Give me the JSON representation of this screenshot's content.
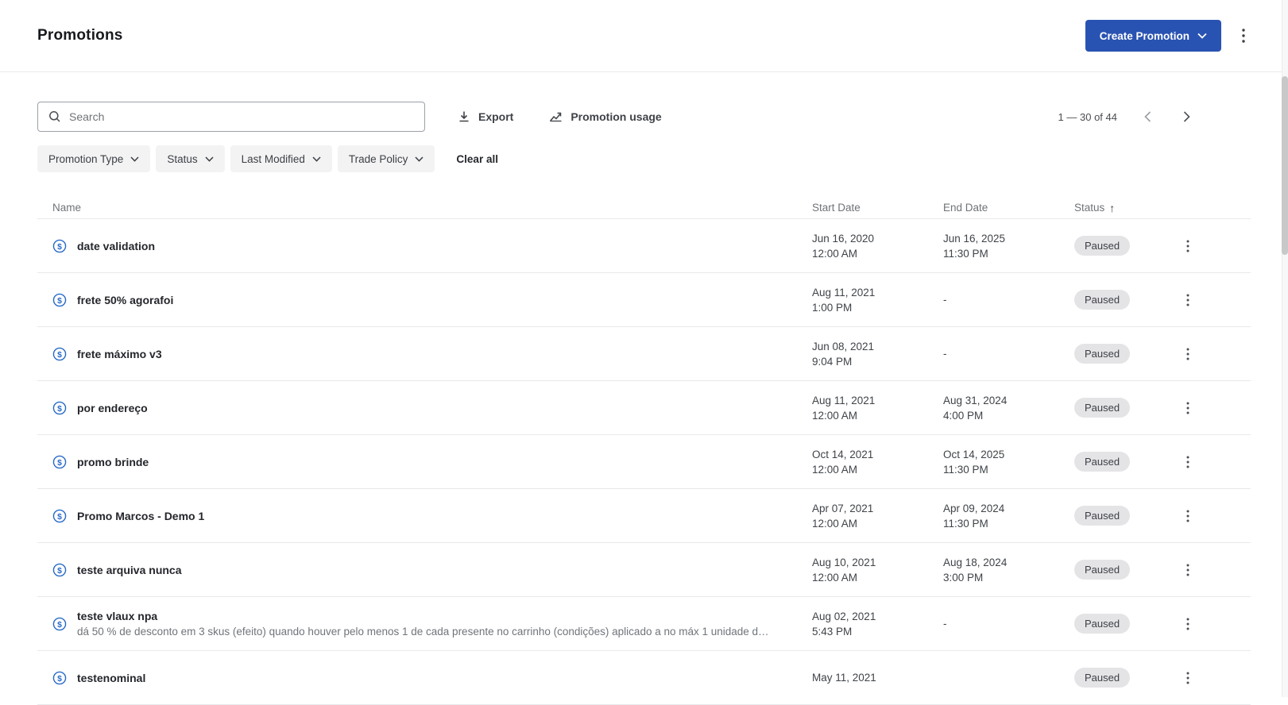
{
  "header": {
    "title": "Promotions",
    "create_button_label": "Create Promotion"
  },
  "toolbar": {
    "search_placeholder": "Search",
    "export_label": "Export",
    "usage_label": "Promotion usage",
    "pagination_range": "1 — 30 of 44"
  },
  "filters": {
    "chips": [
      "Promotion Type",
      "Status",
      "Last Modified",
      "Trade Policy"
    ],
    "clear_all": "Clear all"
  },
  "table": {
    "columns": {
      "name": "Name",
      "start": "Start Date",
      "end": "End Date",
      "status": "Status"
    },
    "sort_indicator": "↑",
    "rows": [
      {
        "name": "date validation",
        "description": "",
        "start": {
          "date": "Jun 16, 2020",
          "time": "12:00 AM"
        },
        "end": {
          "date": "Jun 16, 2025",
          "time": "11:30 PM"
        },
        "status": "Paused"
      },
      {
        "name": "frete 50% agorafoi",
        "description": "",
        "start": {
          "date": "Aug 11, 2021",
          "time": "1:00 PM"
        },
        "end": {
          "date": "-",
          "time": ""
        },
        "status": "Paused"
      },
      {
        "name": "frete máximo v3",
        "description": "",
        "start": {
          "date": "Jun 08, 2021",
          "time": "9:04 PM"
        },
        "end": {
          "date": "-",
          "time": ""
        },
        "status": "Paused"
      },
      {
        "name": "por endereço",
        "description": "",
        "start": {
          "date": "Aug 11, 2021",
          "time": "12:00 AM"
        },
        "end": {
          "date": "Aug 31, 2024",
          "time": "4:00 PM"
        },
        "status": "Paused"
      },
      {
        "name": "promo brinde",
        "description": "",
        "start": {
          "date": "Oct 14, 2021",
          "time": "12:00 AM"
        },
        "end": {
          "date": "Oct 14, 2025",
          "time": "11:30 PM"
        },
        "status": "Paused"
      },
      {
        "name": "Promo Marcos - Demo 1",
        "description": "",
        "start": {
          "date": "Apr 07, 2021",
          "time": "12:00 AM"
        },
        "end": {
          "date": "Apr 09, 2024",
          "time": "11:30 PM"
        },
        "status": "Paused"
      },
      {
        "name": "teste arquiva nunca",
        "description": "",
        "start": {
          "date": "Aug 10, 2021",
          "time": "12:00 AM"
        },
        "end": {
          "date": "Aug 18, 2024",
          "time": "3:00 PM"
        },
        "status": "Paused"
      },
      {
        "name": "teste vlaux npa",
        "description": "dá 50 % de desconto em 3 skus (efeito) quando houver pelo menos 1 de cada presente no carrinho (condições) aplicado a no máx 1 unidade d…",
        "start": {
          "date": "Aug 02, 2021",
          "time": "5:43 PM"
        },
        "end": {
          "date": "-",
          "time": ""
        },
        "status": "Paused"
      },
      {
        "name": "testenominal",
        "description": "",
        "start": {
          "date": "May 11, 2021",
          "time": ""
        },
        "end": {
          "date": "",
          "time": ""
        },
        "status": "Paused"
      }
    ]
  },
  "icons": {
    "search": "magnifier",
    "export": "download-arrow",
    "usage": "trend-line-chart",
    "pagination_prev": "chevron-left",
    "pagination_next": "chevron-right",
    "create_chevron": "chevron-down",
    "chip_chevron": "chevron-down",
    "row_type": "circle-dollar-sign",
    "overflow_menu": "kebab-vertical",
    "sort": "arrow-up"
  },
  "colors": {
    "primary_button": "#2953b2",
    "row_icon_blue": "#2a6bc8",
    "badge_bg": "#e4e4e6",
    "border": "#e8e9ea"
  }
}
